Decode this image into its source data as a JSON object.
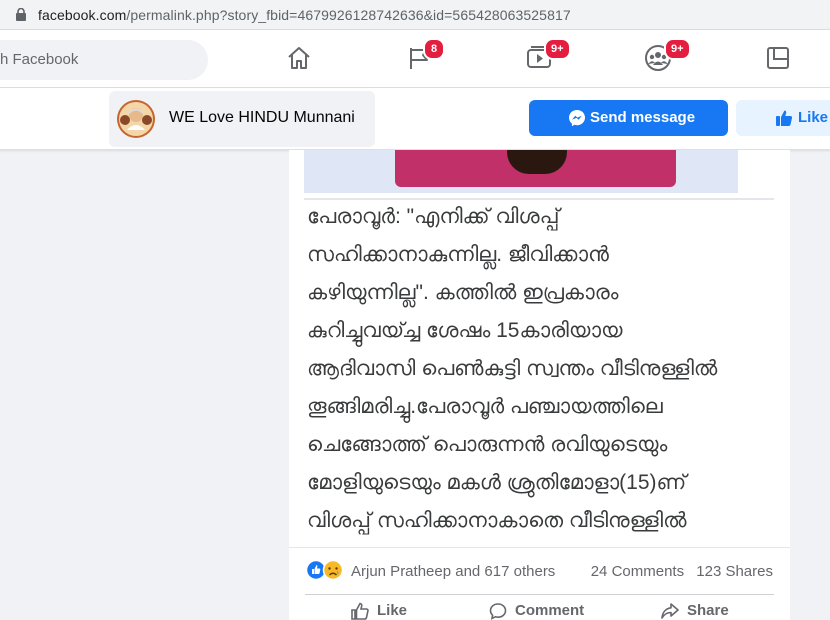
{
  "browser": {
    "url_host": "facebook.com",
    "url_path": "/permalink.php?story_fbid=4679926128742636&id=565428063525817"
  },
  "nav": {
    "search_placeholder": "h Facebook",
    "pages_badge": "8",
    "watch_badge": "9+",
    "groups_badge": "9+"
  },
  "page_header": {
    "name": "WE Love HINDU Munnani",
    "send_message_label": "Send message",
    "like_label": "Like"
  },
  "post": {
    "lines": [
      "പേരാവൂർ: \"എനിക്ക് വിശപ്പ്",
      "സഹിക്കാനാകുന്നില്ല. ജീവിക്കാൻ",
      "കഴിയുന്നില്ല\". കത്തിൽ ഇപ്രകാരം",
      "കുറിച്ചുവയ്ച്ച ശേഷം 15കാരിയായ",
      "ആദിവാസി പെൺകുട്ടി സ്വന്തം വീടിനുള്ളിൽ",
      "തൂങ്ങിമരിച്ചു.പേരാവൂർ പഞ്ചായത്തിലെ",
      "ചെങ്ങോത്ത് പൊരുന്നൻ രവിയുടെയും",
      "മോളിയുടെയും മകൾ ശ്രുതിമോളാ(15)ണ്",
      "വിശപ്പ് സഹിക്കാനാകാതെ വീടിനുള്ളിൽ"
    ],
    "reaction_names": "Arjun Pratheep and 617 others",
    "comments": "24 Comments",
    "shares": "123 Shares",
    "actions": {
      "like": "Like",
      "comment": "Comment",
      "share": "Share"
    }
  },
  "colors": {
    "fb_blue": "#1877f2",
    "badge_red": "#e41e3f",
    "like_bg": "#e7f3ff"
  },
  "icons": [
    "lock-icon",
    "home-icon",
    "pages-flag-icon",
    "watch-icon",
    "groups-icon",
    "gaming-icon",
    "messenger-icon",
    "thumbs-up-icon",
    "sad-reaction-icon"
  ]
}
